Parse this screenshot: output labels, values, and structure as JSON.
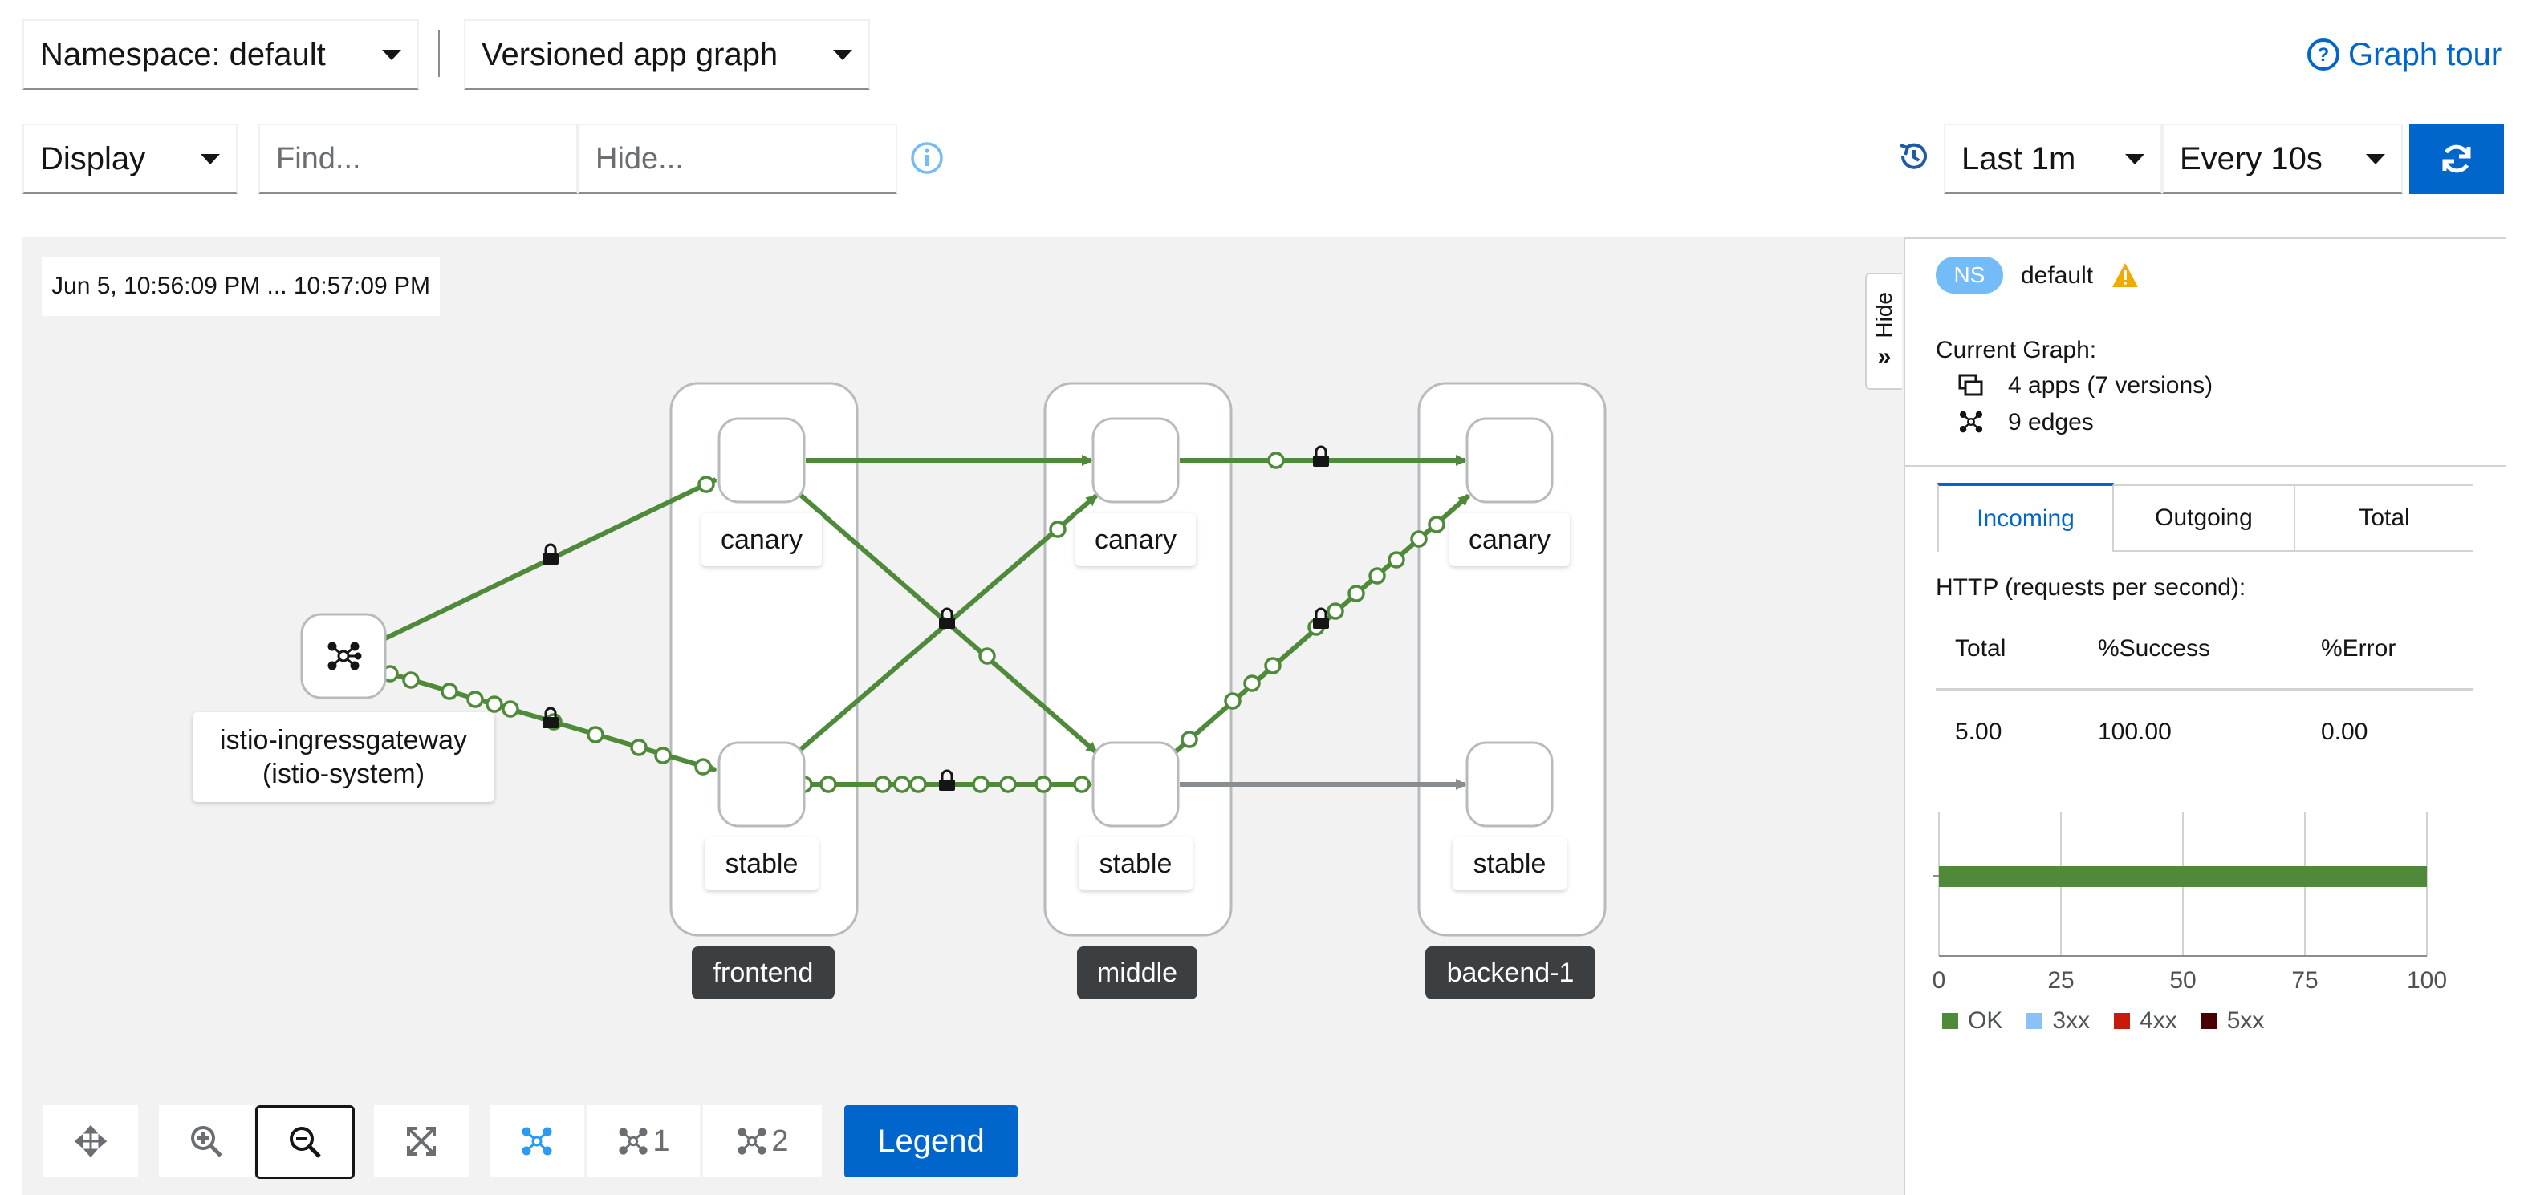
{
  "toolbar": {
    "namespace_label": "Namespace: default",
    "graph_type_label": "Versioned app graph",
    "graph_tour_label": "Graph tour",
    "display_label": "Display",
    "find_placeholder": "Find...",
    "hide_placeholder": "Hide...",
    "duration_label": "Last 1m",
    "refresh_interval_label": "Every 10s"
  },
  "graph": {
    "time_range": "Jun 5, 10:56:09 PM ... 10:57:09 PM",
    "ingress_label_line1": "istio-ingressgateway",
    "ingress_label_line2": "(istio-system)",
    "apps": [
      {
        "name": "frontend",
        "versions": [
          "canary",
          "stable"
        ]
      },
      {
        "name": "middle",
        "versions": [
          "canary",
          "stable"
        ]
      },
      {
        "name": "backend-1",
        "versions": [
          "canary",
          "stable"
        ]
      }
    ],
    "edge_color": "#4f8a3a",
    "idle_edge_color": "#8a8d90"
  },
  "side_panel": {
    "hide_label": "Hide",
    "ns_badge": "NS",
    "namespace": "default",
    "current_graph_label": "Current Graph:",
    "apps_summary": "4 apps (7 versions)",
    "edges_summary": "9 edges",
    "tabs": [
      "Incoming",
      "Outgoing",
      "Total"
    ],
    "active_tab": "Incoming",
    "http_label": "HTTP (requests per second):",
    "table_headers": [
      "Total",
      "%Success",
      "%Error"
    ],
    "table_values": [
      "5.00",
      "100.00",
      "0.00"
    ],
    "chart_ticks": [
      "0",
      "25",
      "50",
      "75",
      "100"
    ],
    "legend": [
      {
        "label": "OK",
        "color": "#4f8a3a"
      },
      {
        "label": "3xx",
        "color": "#8bc1f7"
      },
      {
        "label": "4xx",
        "color": "#c9190b"
      },
      {
        "label": "5xx",
        "color": "#470000"
      }
    ]
  },
  "chart_data": {
    "type": "bar",
    "series": [
      {
        "name": "OK",
        "values": [
          100
        ]
      },
      {
        "name": "3xx",
        "values": [
          0
        ]
      },
      {
        "name": "4xx",
        "values": [
          0
        ]
      },
      {
        "name": "5xx",
        "values": [
          0
        ]
      }
    ],
    "xlim": [
      0,
      100
    ],
    "ticks": [
      0,
      25,
      50,
      75,
      100
    ]
  },
  "bottom_toolbar": {
    "layout_default": "",
    "layout_1": "1",
    "layout_2": "2",
    "legend_label": "Legend"
  }
}
